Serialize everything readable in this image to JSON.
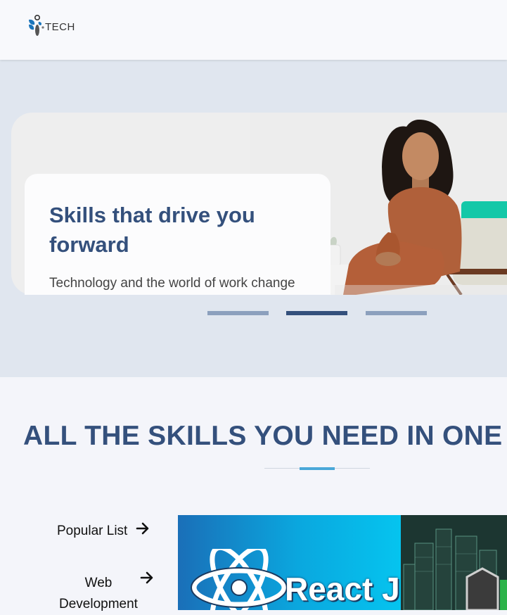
{
  "header": {
    "logo_text": "TECH",
    "logo_icon": "stylized-figure-logo-icon"
  },
  "hero": {
    "title": "Skills that drive you forward",
    "text": "Technology and the world of work change",
    "slides_count": 3,
    "active_slide": 2,
    "colors": {
      "title": "#34507c",
      "indicator": "#8ca0bd",
      "indicator_active": "#34507c"
    }
  },
  "section": {
    "title": "ALL THE SKILLS YOU NEED IN ONE",
    "accent_color": "#4aa8d8"
  },
  "categories": [
    {
      "label": "Popular List",
      "icon": "arrow-right-icon"
    },
    {
      "label": "Web Development",
      "icon": "arrow-right-icon"
    }
  ],
  "courses": [
    {
      "label": "React J",
      "image": "react-logo"
    },
    {
      "label": "",
      "image": "nodejs-city-image"
    }
  ]
}
